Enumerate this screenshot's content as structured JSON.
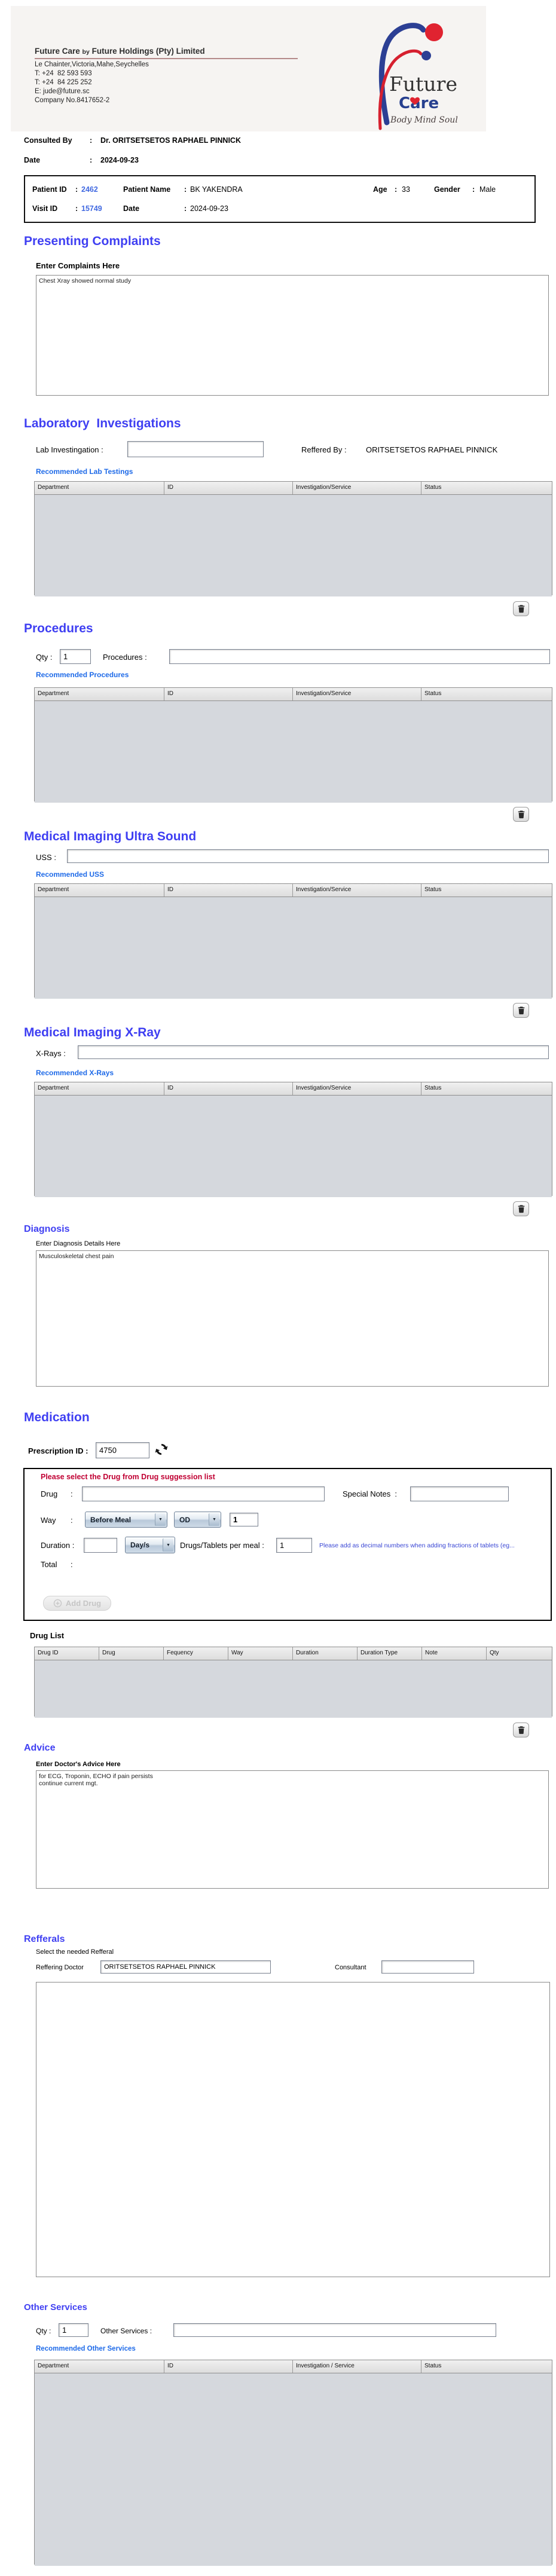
{
  "common": {
    "sep": ":"
  },
  "colors": {
    "heading_blue": "#3F3FF2",
    "link_blue": "#1E6AE8",
    "value_blue": "#4169E1",
    "warning_red": "#C00033",
    "note_blue": "#3946D4",
    "logo_blue": "#2C3F94",
    "logo_red": "#E02330",
    "table_header_bg": "#E6E6E6",
    "table_body_bg": "#D5D8DD"
  },
  "letterhead": {
    "title_1": "Future Care",
    "title_by": "by",
    "title_2": "Future Holdings (Pty) Limited",
    "address_line_1": "Le Chainter,Victoria,Mahe,Seychelles",
    "address_line_2": "T: +24  82 593 593",
    "address_line_3": "T: +24  84 225 252",
    "address_line_4": "E: jude@future.sc",
    "address_line_5": "Company No.8417652-2",
    "logo_word_1": "Future",
    "logo_word_2": "Care",
    "logo_tagline": "Body Mind Soul"
  },
  "consult": {
    "label": "Consulted By",
    "value": "Dr.  ORITSETSETOS RAPHAEL PINNICK",
    "date_label": "Date",
    "date_value": "2024-09-23"
  },
  "patient": {
    "id_label": "Patient ID",
    "id_value": "2462",
    "name_label": "Patient Name",
    "name_value": "BK YAKENDRA",
    "age_label": "Age",
    "age_value": "33",
    "gender_label": "Gender",
    "gender_value": "Male",
    "visit_label": "Visit ID",
    "visit_value": "15749",
    "date_label": "Date",
    "date_value": "2024-09-23"
  },
  "complaints": {
    "heading": "Presenting Complaints",
    "sub": "Enter Complaints Here",
    "text": "Chest Xray showed normal study"
  },
  "lab": {
    "heading": "Laboratory  Investigations",
    "label": "Lab Investingation :",
    "value": "",
    "reffered_label": "Reffered By :",
    "reffered_value": "ORITSETSETOS RAPHAEL PINNICK",
    "link": "Recommended Lab Testings",
    "headers": [
      "Department",
      "ID",
      "Investigation/Service",
      "Status"
    ]
  },
  "procedures": {
    "heading": "Procedures",
    "qty_label": "Qty :",
    "qty_value": "1",
    "label": "Procedures :",
    "value": "",
    "link": "Recommended Procedures",
    "headers": [
      "Department",
      "ID",
      "Investigation/Service",
      "Status"
    ]
  },
  "uss": {
    "heading": "Medical Imaging Ultra Sound",
    "label": "USS :",
    "value": "",
    "link": "Recommended USS",
    "headers": [
      "Department",
      "ID",
      "Investigation/Service",
      "Status"
    ]
  },
  "xray": {
    "heading": "Medical Imaging X-Ray",
    "label": "X-Rays :",
    "value": "",
    "link": "Recommended X-Rays",
    "headers": [
      "Department",
      "ID",
      "Investigation/Service",
      "Status"
    ]
  },
  "diagnosis": {
    "heading": "Diagnosis",
    "sub": "Enter Diagnosis Details Here",
    "text": "Musculoskeletal chest pain"
  },
  "medication": {
    "heading": "Medication",
    "prescription_label": "Prescription ID :",
    "prescription_value": "4750",
    "warning": "Please select the Drug from Drug suggession list",
    "drug_label": "Drug",
    "drug_value": "",
    "special_notes_label": "Special Notes  :",
    "special_notes_value": "",
    "way_label": "Way",
    "way_option": "Before Meal",
    "frequency_option": "OD",
    "way_qty_value": "1",
    "duration_label": "Duration :",
    "duration_value": "",
    "duration_type_option": "Day/s",
    "per_meal_label": "Drugs/Tablets per meal :",
    "per_meal_value": "1",
    "note": "Please add as decimal numbers when adding fractions of tablets (eg...",
    "total_label": "Total",
    "add_drug_label": "Add Drug",
    "drug_list_label": "Drug List",
    "headers": [
      "Drug ID",
      "Drug",
      "Fequency",
      "Way",
      "Duration",
      "Duration Type",
      "Note",
      "Qty"
    ]
  },
  "advice": {
    "heading": "Advice",
    "sub": "Enter Doctor's Advice Here",
    "text": "for ECG, Troponin, ECHO if pain persists\ncontinue current mgt."
  },
  "refferals": {
    "heading": "Refferals",
    "sub": "Select the needed Refferal",
    "doctor_label": "Reffering Doctor",
    "doctor_value": "ORITSETSETOS RAPHAEL PINNICK",
    "consultant_label": "Consultant",
    "consultant_value": ""
  },
  "other": {
    "heading": "Other Services",
    "qty_label": "Qty :",
    "qty_value": "1",
    "label": "Other Services :",
    "value": "",
    "link": "Recommended Other Services",
    "headers": [
      "Department",
      "ID",
      "Investigation / Service",
      "Status"
    ]
  }
}
